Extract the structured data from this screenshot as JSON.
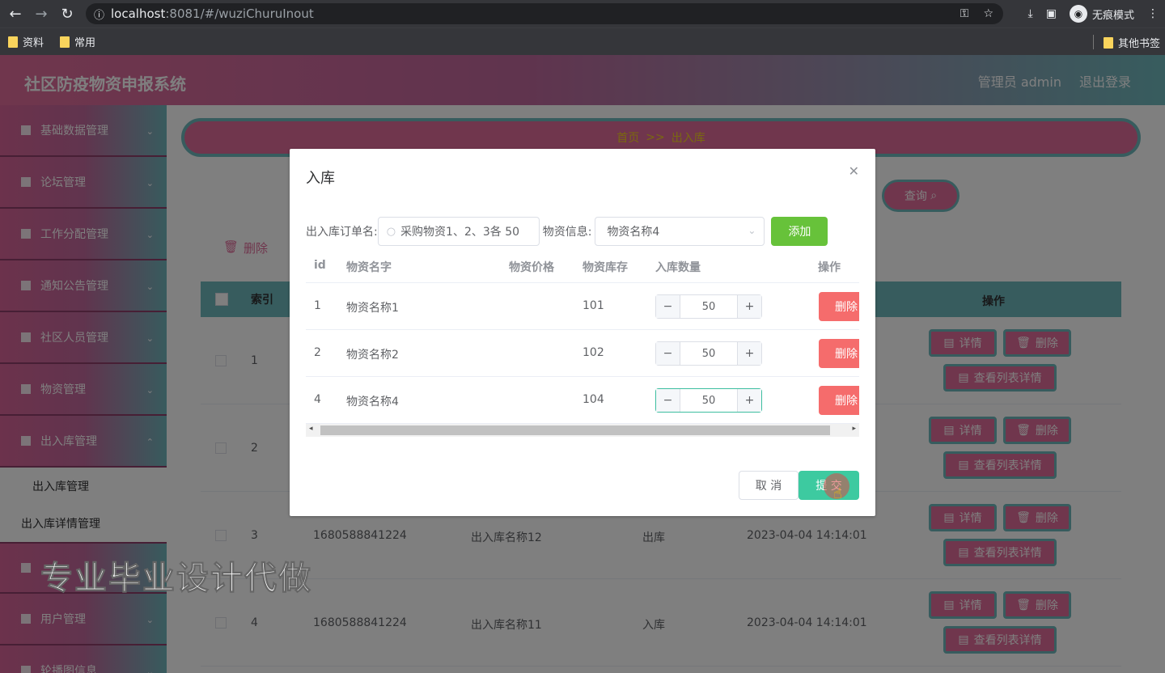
{
  "browser": {
    "url_host": "localhost",
    "url_path": ":8081/#/wuziChuruInout",
    "incognito_label": "无痕模式",
    "bookmarks": [
      "资料",
      "常用"
    ],
    "other_bookmarks": "其他书签"
  },
  "header": {
    "title": "社区防疫物资申报系统",
    "user": "管理员 admin",
    "logout": "退出登录"
  },
  "sidebar": {
    "items": [
      {
        "label": "基础数据管理"
      },
      {
        "label": "论坛管理"
      },
      {
        "label": "工作分配管理"
      },
      {
        "label": "通知公告管理"
      },
      {
        "label": "社区人员管理"
      },
      {
        "label": "物资管理"
      },
      {
        "label": "出入库管理"
      }
    ],
    "sub_items": [
      "出入库管理",
      "出入库详情管理"
    ],
    "items_after": [
      {
        "label": "用户管理"
      },
      {
        "label": "轮播图信息"
      }
    ]
  },
  "main": {
    "breadcrumb": [
      "首页",
      ">>",
      "出入库"
    ],
    "query_button": "查询",
    "delete_button": "删除",
    "table_headers": {
      "index": "索引",
      "operation": "操作"
    },
    "rows": [
      {
        "index": "1"
      },
      {
        "index": "2"
      },
      {
        "index": "3",
        "code": "1680588841224",
        "name": "出入库名称12",
        "type": "出库",
        "time": "2023-04-04 14:14:01"
      },
      {
        "index": "4",
        "code": "1680588841224",
        "name": "出入库名称11",
        "type": "入库",
        "time": "2023-04-04 14:14:01"
      }
    ],
    "op_buttons": {
      "detail": "详情",
      "delete": "删除",
      "list_detail": "查看列表详情"
    }
  },
  "dialog": {
    "title": "入库",
    "order_label": "出入库订单名:",
    "order_value": "采购物资1、2、3各 50",
    "goods_label": "物资信息:",
    "goods_value": "物资名称4",
    "add_button": "添加",
    "headers": {
      "id": "id",
      "name": "物资名字",
      "price": "物资价格",
      "stock": "物资库存",
      "qty": "入库数量",
      "op": "操作"
    },
    "rows": [
      {
        "id": "1",
        "name": "物资名称1",
        "price": "",
        "stock": "101",
        "qty": "50",
        "op": "删除"
      },
      {
        "id": "2",
        "name": "物资名称2",
        "price": "",
        "stock": "102",
        "qty": "50",
        "op": "删除"
      },
      {
        "id": "4",
        "name": "物资名称4",
        "price": "",
        "stock": "104",
        "qty": "50",
        "op": "删除"
      }
    ],
    "cancel": "取 消",
    "submit": "提 交"
  },
  "watermark": "专业毕业设计代做",
  "colors": {
    "accent_pink": "#e06c9a",
    "accent_teal": "#6fb9bd",
    "submit": "#3dcaa0",
    "add": "#67c23a",
    "danger": "#f56c6c"
  }
}
